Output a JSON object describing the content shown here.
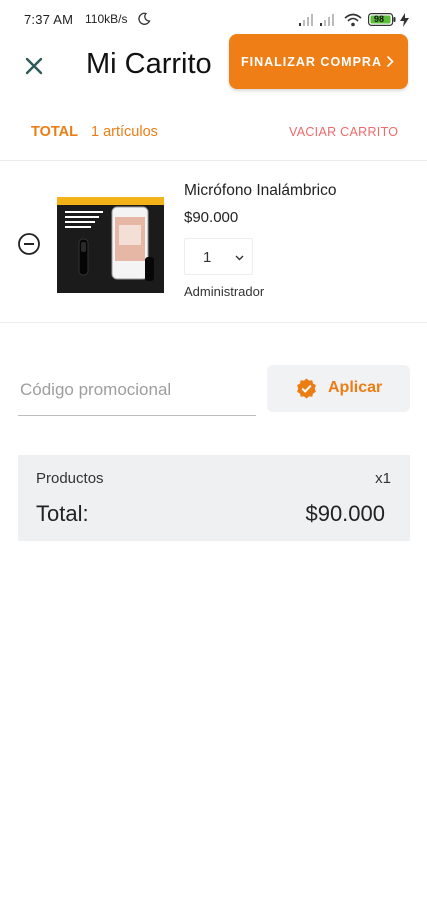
{
  "status_bar": {
    "time": "7:37 AM",
    "speed": "110kB/s",
    "battery": "98"
  },
  "header": {
    "title": "Mi Carrito",
    "checkout_label": "FINALIZAR COMPRA",
    "accent_color": "#f07e17"
  },
  "summary": {
    "total_label": "TOTAL",
    "items_count": "1 artículos",
    "clear_cart_label": "VACIAR CARRITO"
  },
  "cart_items": [
    {
      "name": "Micrófono Inalámbrico",
      "price": "$90.000",
      "quantity": "1",
      "seller": "Administrador"
    }
  ],
  "promo": {
    "placeholder": "Código promocional",
    "apply_label": "Aplicar"
  },
  "totals": {
    "products_label": "Productos",
    "products_qty": "x1",
    "total_label": "Total:",
    "total_value": "$90.000"
  }
}
